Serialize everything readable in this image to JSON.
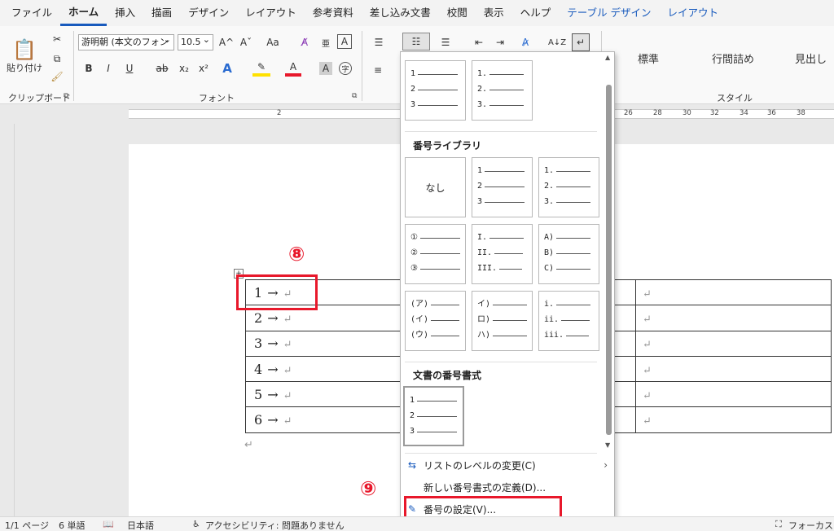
{
  "menu_tabs": [
    "ファイル",
    "ホーム",
    "挿入",
    "描画",
    "デザイン",
    "レイアウト",
    "参考資料",
    "差し込み文書",
    "校閲",
    "表示",
    "ヘルプ",
    "テーブル デザイン",
    "レイアウト"
  ],
  "ribbon": {
    "clipboard": {
      "paste_label": "貼り付け",
      "group_label": "クリップボード"
    },
    "font": {
      "font_name": "游明朝 (本文のフォン",
      "font_size": "10.5",
      "grow": "A^",
      "shrink": "Aˇ",
      "case": "Aa",
      "group_label": "フォント",
      "bold": "B",
      "italic": "I",
      "underline": "U",
      "strike": "ab",
      "subscript": "x₂",
      "superscript": "x²"
    },
    "styles": {
      "items": [
        "標準",
        "行間詰め",
        "見出し"
      ],
      "group_label": "スタイル"
    }
  },
  "ruler_numbers": [
    "2",
    "26",
    "28",
    "30",
    "32",
    "34",
    "36",
    "38"
  ],
  "table": {
    "rows": [
      "1",
      "2",
      "3",
      "4",
      "5",
      "6"
    ],
    "arrow": "→",
    "return_mark": "↵"
  },
  "steps": {
    "step8": "⑧",
    "step9": "⑨"
  },
  "dropdown": {
    "recent": [
      {
        "lines": [
          "1",
          "2",
          "3"
        ]
      },
      {
        "lines": [
          "1.",
          "2.",
          "3."
        ]
      }
    ],
    "library_heading": "番号ライブラリ",
    "library": [
      {
        "none": "なし"
      },
      {
        "lines": [
          "1",
          "2",
          "3"
        ]
      },
      {
        "lines": [
          "1.",
          "2.",
          "3."
        ]
      },
      {
        "lines": [
          "①",
          "②",
          "③"
        ]
      },
      {
        "lines": [
          "I.",
          "II.",
          "III."
        ]
      },
      {
        "lines": [
          "A)",
          "B)",
          "C)"
        ]
      },
      {
        "lines": [
          "(ア)",
          "(イ)",
          "(ウ)"
        ]
      },
      {
        "lines": [
          "イ)",
          "ロ)",
          "ハ)"
        ]
      },
      {
        "lines": [
          "i.",
          "ii.",
          "iii."
        ]
      }
    ],
    "document_heading": "文書の番号書式",
    "document": [
      {
        "lines": [
          "1",
          "2",
          "3"
        ]
      }
    ],
    "menu_items": [
      {
        "label": "リストのレベルの変更(C)",
        "icon": "list-level-icon",
        "has_submenu": true
      },
      {
        "label": "新しい番号書式の定義(D)...",
        "icon": "",
        "has_submenu": false
      },
      {
        "label": "番号の設定(V)...",
        "icon": "numbering-value-icon",
        "has_submenu": false
      }
    ]
  },
  "status": {
    "page": "1/1 ページ",
    "words": "6 単語",
    "language": "日本語",
    "accessibility": "アクセシビリティ: 問題ありません",
    "focus": "フォーカス"
  },
  "colors": {
    "highlight": "#e8182b",
    "accent": "#185abd"
  }
}
